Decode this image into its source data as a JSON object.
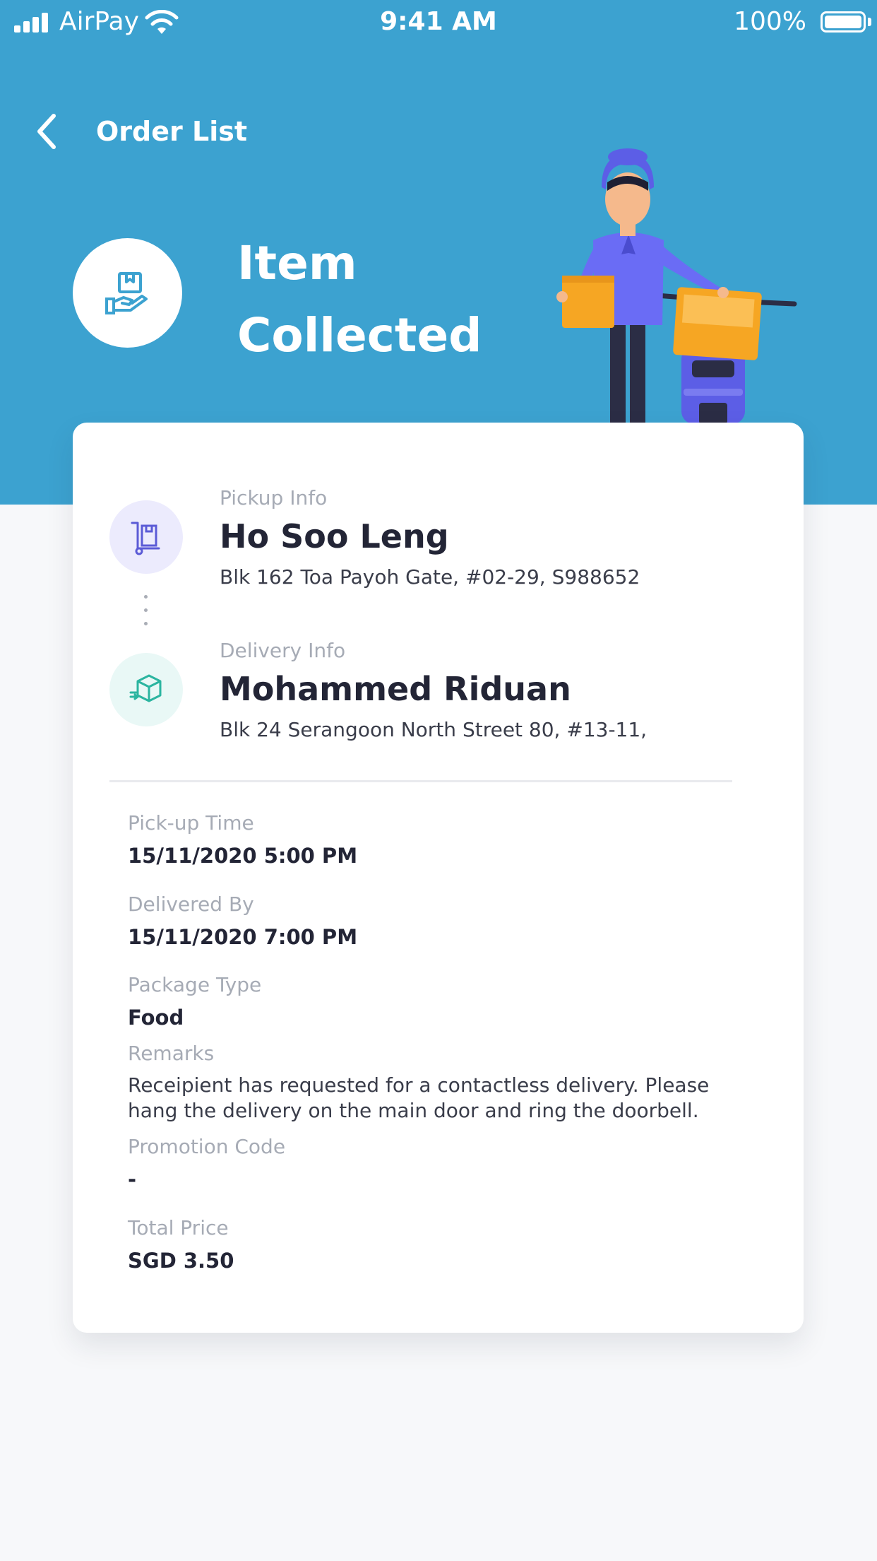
{
  "status_bar": {
    "carrier": "AirPay",
    "time": "9:41 AM",
    "battery": "100%"
  },
  "nav": {
    "back_title": "Order List"
  },
  "status": {
    "title_line1": "Item",
    "title_line2": "Collected"
  },
  "pickup": {
    "label": "Pickup Info",
    "name": "Ho Soo Leng",
    "address": "Blk 162 Toa Payoh Gate, #02-29, S988652"
  },
  "delivery": {
    "label": "Delivery Info",
    "name": "Mohammed Riduan",
    "address": "Blk 24 Serangoon North Street 80, #13-11,"
  },
  "details": {
    "pickup_time_label": "Pick-up Time",
    "pickup_time": "15/11/2020 5:00 PM",
    "delivered_by_label": "Delivered By",
    "delivered_by": "15/11/2020 7:00 PM",
    "package_type_label": "Package Type",
    "package_type": "Food",
    "remarks_label": "Remarks",
    "remarks": "Receipient has requested for a contactless delivery. Please hang the delivery on the main door and ring the doorbell.",
    "promo_label": "Promotion Code",
    "promo": "-",
    "total_label": "Total Price",
    "total": "SGD 3.50"
  },
  "colors": {
    "header": "#3ca2d0",
    "pickup_accent": "#5b5bd6",
    "delivery_accent": "#2bb5a0"
  }
}
